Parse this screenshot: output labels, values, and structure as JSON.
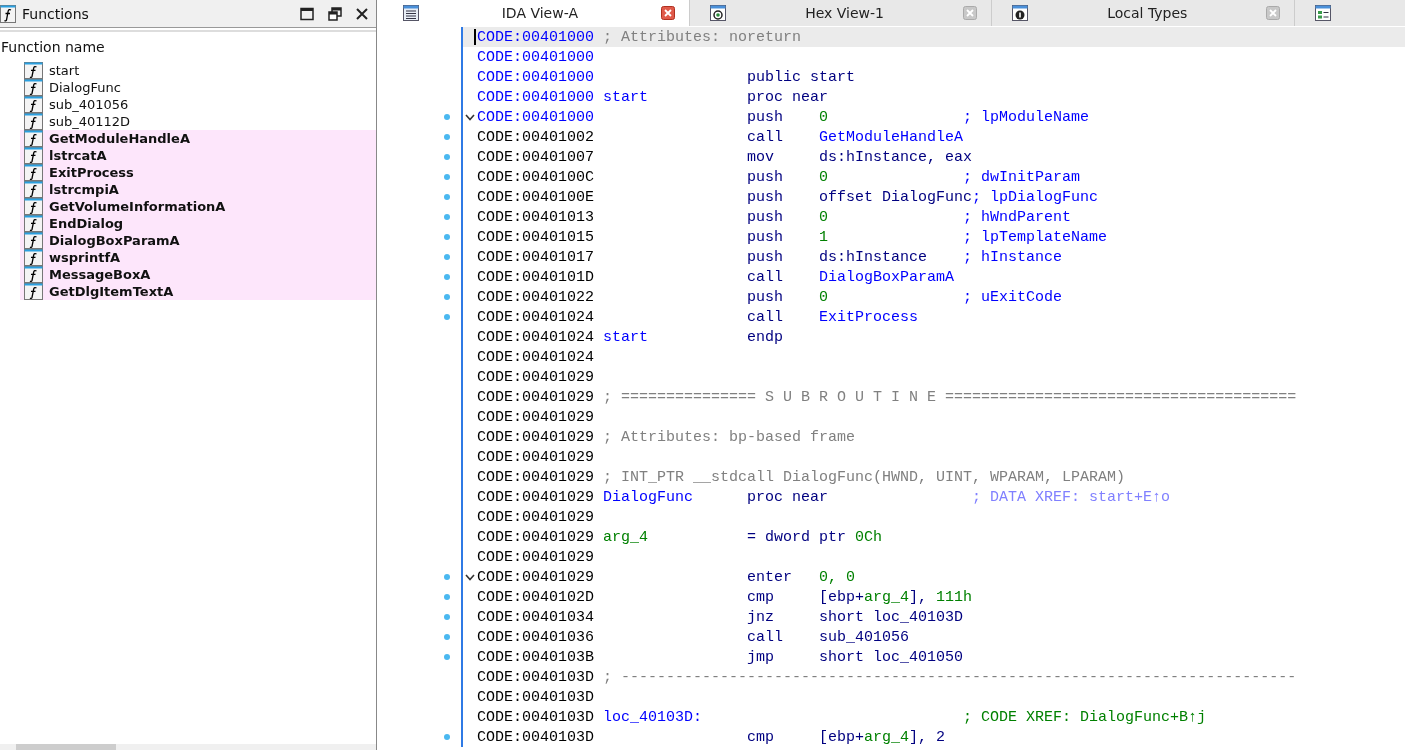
{
  "functions_panel": {
    "title": "Functions",
    "column_header": "Function name",
    "items": [
      {
        "name": "start",
        "kind": "user"
      },
      {
        "name": "DialogFunc",
        "kind": "user"
      },
      {
        "name": "sub_401056",
        "kind": "user"
      },
      {
        "name": "sub_40112D",
        "kind": "user"
      },
      {
        "name": "GetModuleHandleA",
        "kind": "library"
      },
      {
        "name": "lstrcatA",
        "kind": "library"
      },
      {
        "name": "ExitProcess",
        "kind": "library"
      },
      {
        "name": "lstrcmpiA",
        "kind": "library"
      },
      {
        "name": "GetVolumeInformationA",
        "kind": "library"
      },
      {
        "name": "EndDialog",
        "kind": "library"
      },
      {
        "name": "DialogBoxParamA",
        "kind": "library"
      },
      {
        "name": "wsprintfA",
        "kind": "library"
      },
      {
        "name": "MessageBoxA",
        "kind": "library"
      },
      {
        "name": "GetDlgItemTextA",
        "kind": "library"
      }
    ]
  },
  "tabs": [
    {
      "label": "IDA View-A",
      "kind": "listing",
      "selected": true
    },
    {
      "label": "Hex View-1",
      "kind": "hex",
      "selected": false
    },
    {
      "label": "Local Types",
      "kind": "types",
      "selected": false
    },
    {
      "kind": "structures",
      "selected": false
    }
  ],
  "listing": [
    {
      "address": "CODE:00401000",
      "address_highlighted": true,
      "selected": true,
      "dot": false,
      "fold": false,
      "remark": "; Attributes: noreturn"
    },
    {
      "address": "CODE:00401000",
      "address_highlighted": true,
      "selected": false,
      "dot": false,
      "fold": false
    },
    {
      "address": "CODE:00401000",
      "address_highlighted": true,
      "selected": false,
      "dot": false,
      "fold": false,
      "mnemonic": "public start"
    },
    {
      "address": "CODE:00401000",
      "address_highlighted": true,
      "selected": false,
      "dot": false,
      "fold": false,
      "label": {
        "text": "start",
        "kind": "proc"
      },
      "mnemonic": "proc near"
    },
    {
      "address": "CODE:00401000",
      "address_highlighted": true,
      "selected": false,
      "dot": true,
      "fold": true,
      "mnemonic": "push",
      "operands": [
        {
          "text": "0",
          "kind": "number"
        }
      ],
      "comment": {
        "text": "; lpModuleName",
        "kind": "argument"
      }
    },
    {
      "address": "CODE:00401002",
      "address_highlighted": false,
      "selected": false,
      "dot": true,
      "fold": false,
      "mnemonic": "call",
      "operands": [
        {
          "text": "GetModuleHandleA",
          "kind": "name"
        }
      ]
    },
    {
      "address": "CODE:00401007",
      "address_highlighted": false,
      "selected": false,
      "dot": true,
      "fold": false,
      "mnemonic": "mov",
      "operands": [
        {
          "text": "ds:hInstance, eax",
          "kind": "plain"
        }
      ]
    },
    {
      "address": "CODE:0040100C",
      "address_highlighted": false,
      "selected": false,
      "dot": true,
      "fold": false,
      "mnemonic": "push",
      "operands": [
        {
          "text": "0",
          "kind": "number"
        }
      ],
      "comment": {
        "text": "; dwInitParam",
        "kind": "argument"
      }
    },
    {
      "address": "CODE:0040100E",
      "address_highlighted": false,
      "selected": false,
      "dot": true,
      "fold": false,
      "mnemonic": "push",
      "operands": [
        {
          "text": "offset DialogFunc",
          "kind": "plain"
        }
      ],
      "comment": {
        "text": "; lpDialogFunc",
        "kind": "argument"
      }
    },
    {
      "address": "CODE:00401013",
      "address_highlighted": false,
      "selected": false,
      "dot": true,
      "fold": false,
      "mnemonic": "push",
      "operands": [
        {
          "text": "0",
          "kind": "number"
        }
      ],
      "comment": {
        "text": "; hWndParent",
        "kind": "argument"
      }
    },
    {
      "address": "CODE:00401015",
      "address_highlighted": false,
      "selected": false,
      "dot": true,
      "fold": false,
      "mnemonic": "push",
      "operands": [
        {
          "text": "1",
          "kind": "number"
        }
      ],
      "comment": {
        "text": "; lpTemplateName",
        "kind": "argument"
      }
    },
    {
      "address": "CODE:00401017",
      "address_highlighted": false,
      "selected": false,
      "dot": true,
      "fold": false,
      "mnemonic": "push",
      "operands": [
        {
          "text": "ds:hInstance",
          "kind": "plain"
        }
      ],
      "comment": {
        "text": "; hInstance",
        "kind": "argument"
      }
    },
    {
      "address": "CODE:0040101D",
      "address_highlighted": false,
      "selected": false,
      "dot": true,
      "fold": false,
      "mnemonic": "call",
      "operands": [
        {
          "text": "DialogBoxParamA",
          "kind": "name"
        }
      ]
    },
    {
      "address": "CODE:00401022",
      "address_highlighted": false,
      "selected": false,
      "dot": true,
      "fold": false,
      "mnemonic": "push",
      "operands": [
        {
          "text": "0",
          "kind": "number"
        }
      ],
      "comment": {
        "text": "; uExitCode",
        "kind": "argument"
      }
    },
    {
      "address": "CODE:00401024",
      "address_highlighted": false,
      "selected": false,
      "dot": true,
      "fold": false,
      "mnemonic": "call",
      "operands": [
        {
          "text": "ExitProcess",
          "kind": "name"
        }
      ]
    },
    {
      "address": "CODE:00401024",
      "address_highlighted": false,
      "selected": false,
      "dot": false,
      "fold": false,
      "label": {
        "text": "start",
        "kind": "proc"
      },
      "mnemonic": "endp"
    },
    {
      "address": "CODE:00401024",
      "address_highlighted": false,
      "selected": false,
      "dot": false,
      "fold": false
    },
    {
      "address": "CODE:00401029",
      "address_highlighted": false,
      "selected": false,
      "dot": false,
      "fold": false
    },
    {
      "address": "CODE:00401029",
      "address_highlighted": false,
      "selected": false,
      "dot": false,
      "fold": false,
      "remark": "; =============== S U B R O U T I N E ======================================="
    },
    {
      "address": "CODE:00401029",
      "address_highlighted": false,
      "selected": false,
      "dot": false,
      "fold": false
    },
    {
      "address": "CODE:00401029",
      "address_highlighted": false,
      "selected": false,
      "dot": false,
      "fold": false,
      "remark": "; Attributes: bp-based frame"
    },
    {
      "address": "CODE:00401029",
      "address_highlighted": false,
      "selected": false,
      "dot": false,
      "fold": false
    },
    {
      "address": "CODE:00401029",
      "address_highlighted": false,
      "selected": false,
      "dot": false,
      "fold": false,
      "remark": "; INT_PTR __stdcall DialogFunc(HWND, UINT, WPARAM, LPARAM)"
    },
    {
      "address": "CODE:00401029",
      "address_highlighted": false,
      "selected": false,
      "dot": false,
      "fold": false,
      "label": {
        "text": "DialogFunc",
        "kind": "proc"
      },
      "mnemonic": "proc near",
      "comment": {
        "text": "; DATA XREF: start+E↑o",
        "kind": "data_xref"
      }
    },
    {
      "address": "CODE:00401029",
      "address_highlighted": false,
      "selected": false,
      "dot": false,
      "fold": false
    },
    {
      "address": "CODE:00401029",
      "address_highlighted": false,
      "selected": false,
      "dot": false,
      "fold": false,
      "label": {
        "text": "arg_4",
        "kind": "variable"
      },
      "mnemonic": "= dword ptr",
      "operands": [
        {
          "text": " 0Ch",
          "kind": "number"
        }
      ]
    },
    {
      "address": "CODE:00401029",
      "address_highlighted": false,
      "selected": false,
      "dot": false,
      "fold": false
    },
    {
      "address": "CODE:00401029",
      "address_highlighted": false,
      "selected": false,
      "dot": true,
      "fold": true,
      "mnemonic": "enter",
      "operands": [
        {
          "text": "0, 0",
          "kind": "number"
        }
      ]
    },
    {
      "address": "CODE:0040102D",
      "address_highlighted": false,
      "selected": false,
      "dot": true,
      "fold": false,
      "mnemonic": "cmp",
      "operands": [
        {
          "text": "[ebp+",
          "kind": "plain"
        },
        {
          "text": "arg_4",
          "kind": "number"
        },
        {
          "text": "], ",
          "kind": "plain"
        },
        {
          "text": "111h",
          "kind": "number"
        }
      ]
    },
    {
      "address": "CODE:00401034",
      "address_highlighted": false,
      "selected": false,
      "dot": true,
      "fold": false,
      "mnemonic": "jnz",
      "operands": [
        {
          "text": "short loc_40103D",
          "kind": "plain"
        }
      ]
    },
    {
      "address": "CODE:00401036",
      "address_highlighted": false,
      "selected": false,
      "dot": true,
      "fold": false,
      "mnemonic": "call",
      "operands": [
        {
          "text": "sub_401056",
          "kind": "plain"
        }
      ]
    },
    {
      "address": "CODE:0040103B",
      "address_highlighted": false,
      "selected": false,
      "dot": true,
      "fold": false,
      "mnemonic": "jmp",
      "operands": [
        {
          "text": "short loc_401050",
          "kind": "plain"
        }
      ]
    },
    {
      "address": "CODE:0040103D",
      "address_highlighted": false,
      "selected": false,
      "dot": false,
      "fold": false,
      "remark": "; ---------------------------------------------------------------------------"
    },
    {
      "address": "CODE:0040103D",
      "address_highlighted": false,
      "selected": false,
      "dot": false,
      "fold": false
    },
    {
      "address": "CODE:0040103D",
      "address_highlighted": false,
      "selected": false,
      "dot": false,
      "fold": false,
      "label": {
        "text": "loc_40103D:",
        "kind": "proc"
      },
      "comment": {
        "text": "; CODE XREF: DialogFunc+B↑j",
        "kind": "code_xref"
      }
    },
    {
      "address": "CODE:0040103D",
      "address_highlighted": false,
      "selected": false,
      "dot": true,
      "fold": false,
      "mnemonic": "cmp",
      "operands": [
        {
          "text": "[ebp+",
          "kind": "plain"
        },
        {
          "text": "arg_4",
          "kind": "number"
        },
        {
          "text": "], 2",
          "kind": "plain"
        }
      ]
    }
  ]
}
